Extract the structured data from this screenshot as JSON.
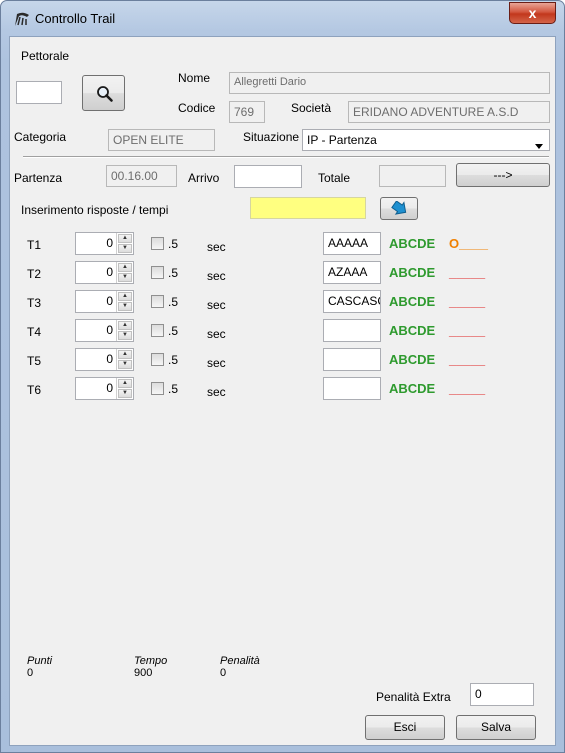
{
  "window": {
    "title": "Controllo Trail",
    "close_label": "x"
  },
  "icons": {
    "app": "trail-app-icon",
    "search": "search-icon",
    "arrow": "arrow-down-right-icon"
  },
  "header": {
    "pettorale_label": "Pettorale",
    "pettorale_value": "",
    "nome_label": "Nome",
    "nome_value": "Allegretti Dario",
    "codice_label": "Codice",
    "codice_value": "769",
    "societa_label": "Società",
    "societa_value": "ERIDANO ADVENTURE A.S.D",
    "categoria_label": "Categoria",
    "categoria_value": "OPEN ELITE",
    "situazione_label": "Situazione",
    "situazione_value": "IP - Partenza"
  },
  "timing": {
    "partenza_label": "Partenza",
    "partenza_value": "00.16.00",
    "arrivo_label": "Arrivo",
    "arrivo_value": "",
    "totale_label": "Totale",
    "totale_value": "",
    "arrow_button_label": "--->",
    "inserimento_label": "Inserimento risposte / tempi",
    "inserimento_value": ""
  },
  "rows": [
    {
      "label": "T1",
      "value": "0",
      "half": ".5",
      "unit": "sec",
      "answer": "AAAAA",
      "key": "ABCDE",
      "result": "O____",
      "result_color": "#f08000"
    },
    {
      "label": "T2",
      "value": "0",
      "half": ".5",
      "unit": "sec",
      "answer": "AZAAA",
      "key": "ABCDE",
      "result": "_____",
      "result_color": "#e02020"
    },
    {
      "label": "T3",
      "value": "0",
      "half": ".5",
      "unit": "sec",
      "answer": "CASCASC",
      "key": "ABCDE",
      "result": "_____",
      "result_color": "#e02020"
    },
    {
      "label": "T4",
      "value": "0",
      "half": ".5",
      "unit": "sec",
      "answer": "",
      "key": "ABCDE",
      "result": "_____",
      "result_color": "#e02020"
    },
    {
      "label": "T5",
      "value": "0",
      "half": ".5",
      "unit": "sec",
      "answer": "",
      "key": "ABCDE",
      "result": "_____",
      "result_color": "#e02020"
    },
    {
      "label": "T6",
      "value": "0",
      "half": ".5",
      "unit": "sec",
      "answer": "",
      "key": "ABCDE",
      "result": "_____",
      "result_color": "#e02020"
    }
  ],
  "footer": {
    "punti_label": "Punti",
    "punti_value": "0",
    "tempo_label": "Tempo",
    "tempo_value": "900",
    "penalita_label": "Penalità",
    "penalita_value": "0",
    "penalita_extra_label": "Penalità Extra",
    "penalita_extra_value": "0",
    "esci_label": "Esci",
    "salva_label": "Salva"
  },
  "colors": {
    "key_green": "#2e9a2e",
    "highlight_yellow": "#ffff80",
    "arrow_blue": "#1e90d0"
  }
}
